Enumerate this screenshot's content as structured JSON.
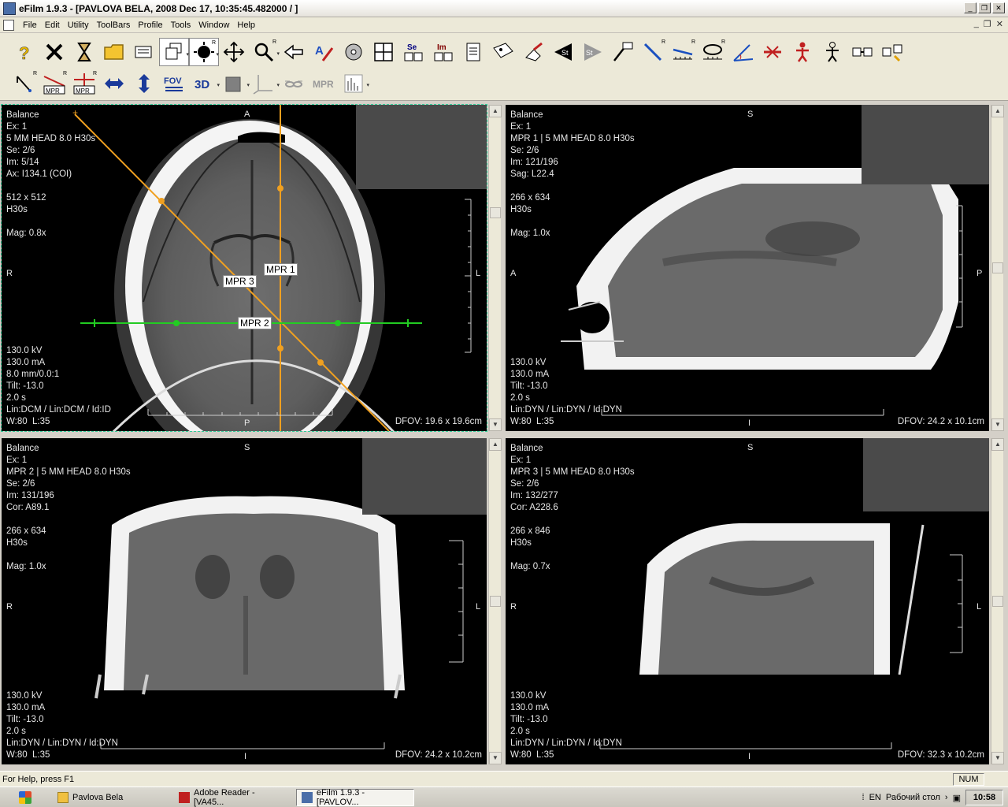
{
  "window": {
    "title": "eFilm 1.9.3 - [PAVLOVA BELA, 2008 Dec 17, 10:35:45.482000  /  ]"
  },
  "menu": [
    "File",
    "Edit",
    "Utility",
    "ToolBars",
    "Profile",
    "Tools",
    "Window",
    "Help"
  ],
  "toolbar": {
    "row1": [
      {
        "name": "help-icon"
      },
      {
        "name": "close-study-icon"
      },
      {
        "name": "hourglass-icon"
      },
      {
        "name": "open-folder-icon"
      },
      {
        "name": "study-list-icon"
      },
      {
        "name": "cascade-icon"
      },
      {
        "name": "window-level-icon"
      },
      {
        "name": "pan-icon"
      },
      {
        "name": "zoom-icon"
      },
      {
        "name": "arrow-back-icon"
      },
      {
        "name": "annotate-text-icon"
      },
      {
        "name": "cine-icon"
      },
      {
        "name": "layout-grid-icon"
      },
      {
        "name": "series-layout-icon",
        "text": "Se"
      },
      {
        "name": "image-layout-icon",
        "text": "Im"
      },
      {
        "name": "report-icon"
      },
      {
        "name": "key-image-icon"
      },
      {
        "name": "eraser-icon"
      },
      {
        "name": "previous-study-icon",
        "text": "St"
      },
      {
        "name": "next-study-icon",
        "text": "St"
      },
      {
        "name": "probe-icon"
      },
      {
        "name": "line-measure-icon"
      },
      {
        "name": "ruler-icon"
      },
      {
        "name": "ellipse-roi-icon"
      },
      {
        "name": "angle-icon"
      },
      {
        "name": "cross-icon"
      },
      {
        "name": "person-icon"
      },
      {
        "name": "person-reset-icon"
      },
      {
        "name": "link-series-icon"
      },
      {
        "name": "sync-icon"
      }
    ],
    "row2": [
      {
        "name": "rotate-icon"
      },
      {
        "name": "mpr-line-icon",
        "text": "MPR"
      },
      {
        "name": "mpr-cross-icon",
        "text": "MPR"
      },
      {
        "name": "flip-horizontal-icon"
      },
      {
        "name": "flip-vertical-icon"
      },
      {
        "name": "fov-icon",
        "text": "FOV"
      },
      {
        "name": "3d-icon",
        "text": "3D"
      },
      {
        "name": "cube-icon"
      },
      {
        "name": "axes-icon"
      },
      {
        "name": "glasses-icon"
      },
      {
        "name": "mpr-disabled-icon",
        "text": "MPR"
      },
      {
        "name": "histogram-icon"
      }
    ]
  },
  "viewports": [
    {
      "id": "axial",
      "top_left": [
        "Balance",
        "Ex: 1",
        "5 MM HEAD 8.0 H30s",
        "Se: 2/6",
        "Im: 5/14",
        "Ax: I134.1 (COI)",
        "",
        "512 x 512",
        "H30s",
        "",
        "Mag: 0.8x"
      ],
      "bottom_left": [
        "130.0 kV",
        "130.0 mA",
        "8.0 mm/0.0:1",
        "Tilt: -13.0",
        "2.0 s",
        "Lin:DCM / Lin:DCM / Id:ID",
        "W:80  L:35"
      ],
      "bottom_right": "DFOV: 19.6 x 19.6cm",
      "orient": {
        "top": "A",
        "left": "R",
        "right": "L",
        "bottom": "P"
      },
      "mpr_labels": [
        "MPR 1",
        "MPR 3",
        "MPR 2"
      ]
    },
    {
      "id": "sagittal",
      "top_left": [
        "Balance",
        "Ex: 1",
        "MPR 1 | 5 MM HEAD 8.0 H30s",
        "Se: 2/6",
        "Im: 121/196",
        "Sag: L22.4",
        "",
        "266 x 634",
        "H30s",
        "",
        "Mag: 1.0x"
      ],
      "bottom_left": [
        "130.0 kV",
        "130.0 mA",
        "Tilt: -13.0",
        "2.0 s",
        "Lin:DYN / Lin:DYN / Id:DYN",
        "W:80  L:35"
      ],
      "bottom_right": "DFOV: 24.2 x 10.1cm",
      "orient": {
        "top": "S",
        "left": "A",
        "right": "P",
        "bottom": "I"
      }
    },
    {
      "id": "coronal",
      "top_left": [
        "Balance",
        "Ex: 1",
        "MPR 2 | 5 MM HEAD 8.0 H30s",
        "Se: 2/6",
        "Im: 131/196",
        "Cor: A89.1",
        "",
        "266 x 634",
        "H30s",
        "",
        "Mag: 1.0x"
      ],
      "bottom_left": [
        "130.0 kV",
        "130.0 mA",
        "Tilt: -13.0",
        "2.0 s",
        "Lin:DYN / Lin:DYN / Id:DYN",
        "W:80  L:35"
      ],
      "bottom_right": "DFOV: 24.2 x 10.2cm",
      "orient": {
        "top": "S",
        "left": "R",
        "right": "L",
        "bottom": "I"
      }
    },
    {
      "id": "oblique",
      "top_left": [
        "Balance",
        "Ex: 1",
        "MPR 3 | 5 MM HEAD 8.0 H30s",
        "Se: 2/6",
        "Im: 132/277",
        "Cor: A228.6",
        "",
        "266 x 846",
        "H30s",
        "",
        "Mag: 0.7x"
      ],
      "bottom_left": [
        "130.0 kV",
        "130.0 mA",
        "Tilt: -13.0",
        "2.0 s",
        "Lin:DYN / Lin:DYN / Id:DYN",
        "W:80  L:35"
      ],
      "bottom_right": "DFOV: 32.3 x 10.2cm",
      "orient": {
        "top": "S",
        "left": "R",
        "right": "L",
        "bottom": "I"
      }
    }
  ],
  "status": {
    "help": "For Help, press F1",
    "num": "NUM"
  },
  "taskbar": {
    "tasks": [
      "Pavlova Bela",
      "Adobe Reader - [VA45...",
      "eFilm 1.9.3 - [PAVLOV..."
    ],
    "lang": "EN",
    "desktop": "Рабочий стол",
    "clock": "10:58"
  },
  "colors": {
    "mpr_orange": "#f0a020",
    "mpr_green": "#22cc22",
    "overlay_text": "#e6e6e6"
  }
}
